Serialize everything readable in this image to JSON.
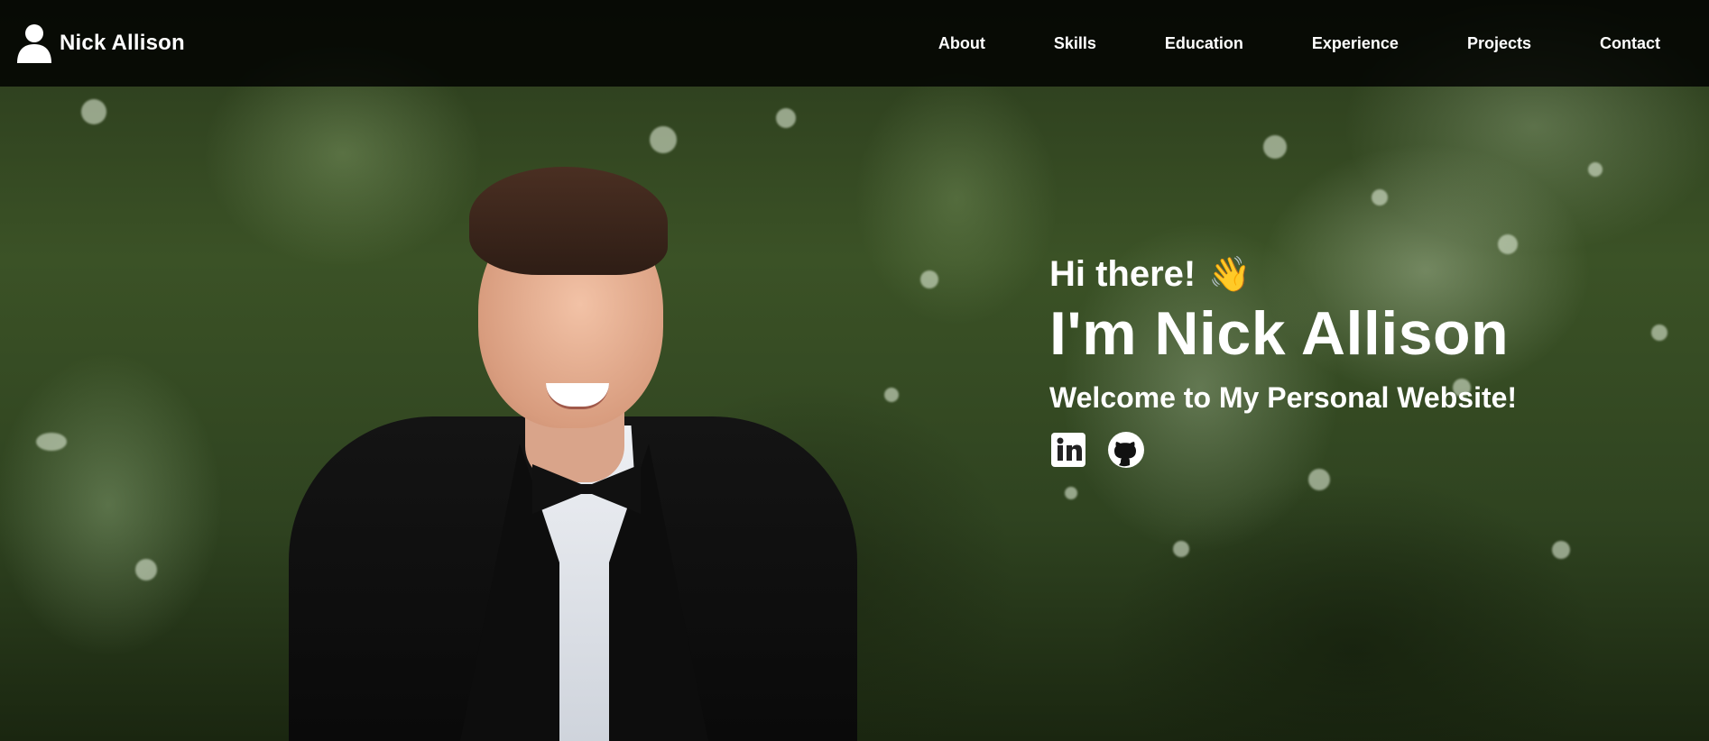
{
  "nav": {
    "brand_name": "Nick Allison",
    "links": [
      "About",
      "Skills",
      "Education",
      "Experience",
      "Projects",
      "Contact"
    ]
  },
  "hero": {
    "greeting": "Hi there!",
    "wave_emoji": "👋",
    "name": "I'm Nick Allison",
    "tagline": "Welcome to My Personal Website!",
    "social_icons": [
      "linkedin-icon",
      "github-icon"
    ]
  },
  "colors": {
    "navbar_bg": "#000000",
    "text": "#ffffff",
    "wave": "#f5b82e"
  }
}
